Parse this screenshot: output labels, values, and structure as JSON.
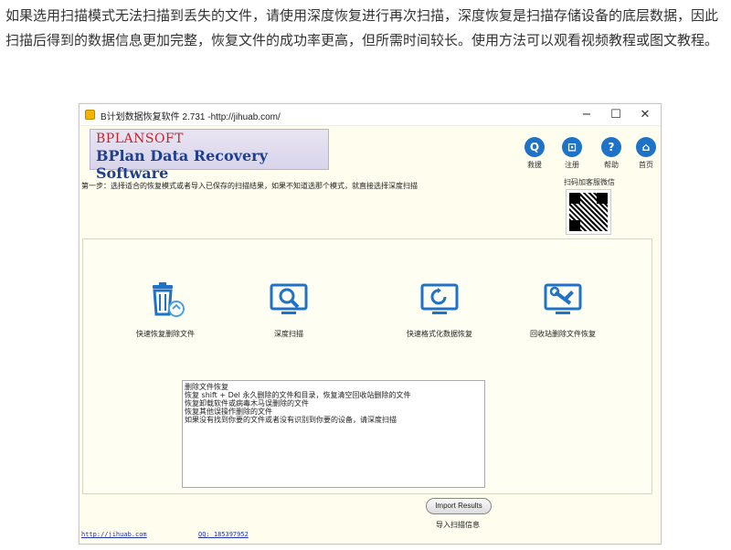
{
  "intro": {
    "text": "如果选用扫描模式无法扫描到丢失的文件，请使用深度恢复进行再次扫描，深度恢复是扫描存储设备的底层数据，因此扫描后得到的数据信息更加完整，恢复文件的成功率更高，但所需时间较长。使用方法可以观看视频教程或图文教程。"
  },
  "window": {
    "title": "B计划数据恢复软件 2.731 -http://jihuab.com/",
    "controls": {
      "minimize": "−",
      "maximize": "☐",
      "close": "✕"
    }
  },
  "logo": {
    "top": "BPLANSOFT",
    "main": "BPlan Data Recovery Software"
  },
  "toolbar": {
    "items": [
      {
        "label": "救援",
        "icon": "search-icon",
        "glyph": "Q"
      },
      {
        "label": "注册",
        "icon": "cart-icon",
        "glyph": "⊡"
      },
      {
        "label": "帮助",
        "icon": "help-icon",
        "glyph": "?"
      },
      {
        "label": "首页",
        "icon": "home-icon",
        "glyph": "⌂"
      }
    ]
  },
  "qr": {
    "label": "扫码加客服微信"
  },
  "step": {
    "text": "第一步：选择适合的恢复模式或者导入已保存的扫描结果，如果不知道选那个模式，就直接选择深度扫描"
  },
  "options": [
    {
      "label": "快速恢复删除文件",
      "icon": "recycle-bin-icon"
    },
    {
      "label": "深度扫描",
      "icon": "magnifier-monitor-icon"
    },
    {
      "label": "快速格式化数据恢复",
      "icon": "refresh-monitor-icon"
    },
    {
      "label": "回收站删除文件恢复",
      "icon": "wrench-monitor-icon"
    }
  ],
  "description": {
    "lines": [
      "删除文件恢复",
      "恢复 shift + Del 永久删除的文件和目录，恢复清空回收站删除的文件",
      "恢复卸载软件或病毒木马误删除的文件",
      "恢复其他误操作删除的文件",
      "如果没有找到你要的文件或者没有识别到你要的设备，请深度扫描"
    ]
  },
  "import": {
    "button": "Import Results",
    "label": "导入扫描信息"
  },
  "footer": {
    "link": "http://jihuab.com",
    "qq": "QQ: 185397952"
  },
  "colors": {
    "accent": "#1e73c9",
    "window_bg": "#fefdee",
    "logo_red": "#c2262b",
    "logo_blue": "#1f3f8f"
  }
}
